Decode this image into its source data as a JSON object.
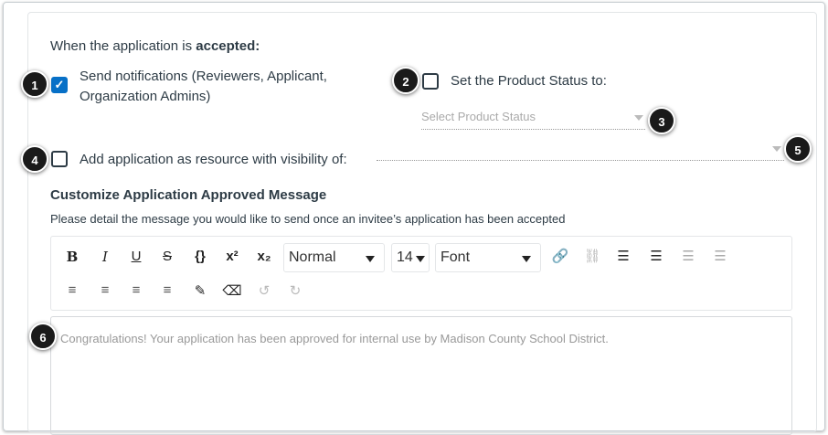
{
  "heading_prefix": "When the application is ",
  "heading_bold": "accepted:",
  "send_notifications": {
    "label_line1": "Send notifications (Reviewers, Applicant,",
    "label_line2": "Organization Admins)",
    "checked": true
  },
  "product_status": {
    "label": "Set the Product Status to:",
    "checked": false,
    "placeholder": "Select Product Status"
  },
  "resource": {
    "label": "Add application as resource with visibility of:",
    "checked": false
  },
  "message_section": {
    "title": "Customize Application Approved Message",
    "description": "Please detail the message you would like to send once an invitee’s application has been accepted"
  },
  "toolbar": {
    "bold": "B",
    "italic": "I",
    "underline": "U",
    "strike": "S",
    "code": "{}",
    "superscript": "x²",
    "subscript": "x₂",
    "format": "Normal",
    "size": "14",
    "font": "Font"
  },
  "editor": {
    "content": "Congratulations! Your application has been approved for internal use by Madison County School District."
  },
  "badges": [
    "1",
    "2",
    "3",
    "4",
    "5",
    "6"
  ]
}
